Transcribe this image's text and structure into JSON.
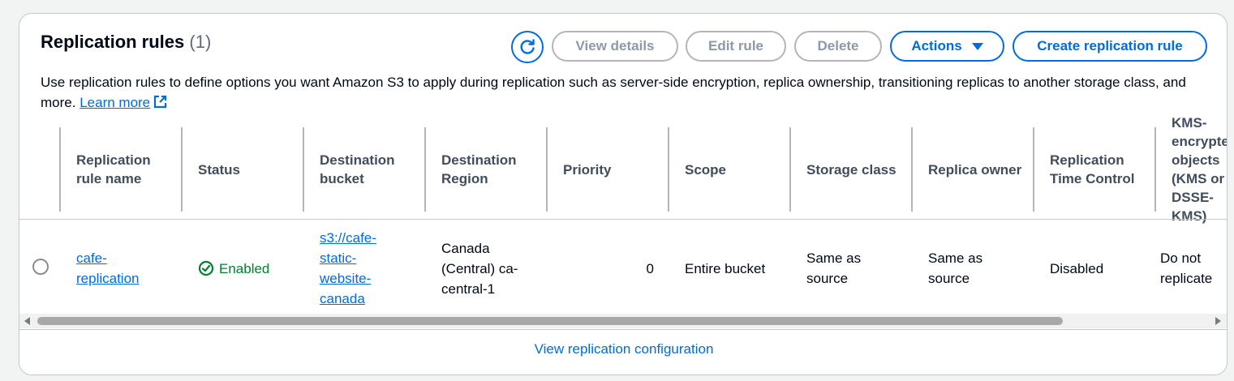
{
  "header": {
    "title": "Replication rules",
    "count": "(1)",
    "description": "Use replication rules to define options you want Amazon S3 to apply during replication such as server-side encryption, replica ownership, transitioning replicas to another storage class, and more.",
    "learn_more": "Learn more"
  },
  "toolbar": {
    "refresh_icon": "refresh-icon",
    "view_details": "View details",
    "edit_rule": "Edit rule",
    "delete": "Delete",
    "actions": "Actions",
    "create_rule": "Create replication rule"
  },
  "table": {
    "columns": [
      "Replication rule name",
      "Status",
      "Destination bucket",
      "Destination Region",
      "Priority",
      "Scope",
      "Storage class",
      "Replica owner",
      "Replication Time Control",
      "KMS-encrypted objects (KMS or DSSE-KMS)"
    ],
    "rows": [
      {
        "name": "cafe-replication",
        "status": "Enabled",
        "destination_bucket": "s3://cafe-static-website-canada",
        "destination_region": "Canada (Central) ca-central-1",
        "priority": "0",
        "scope": "Entire bucket",
        "storage_class": "Same as source",
        "replica_owner": "Same as source",
        "rtc": "Disabled",
        "kms": "Do not replicate"
      }
    ]
  },
  "footer": {
    "view_config": "View replication configuration"
  },
  "colors": {
    "accent": "#006ce0",
    "success": "#00802f",
    "disabled": "#8d99a8"
  }
}
